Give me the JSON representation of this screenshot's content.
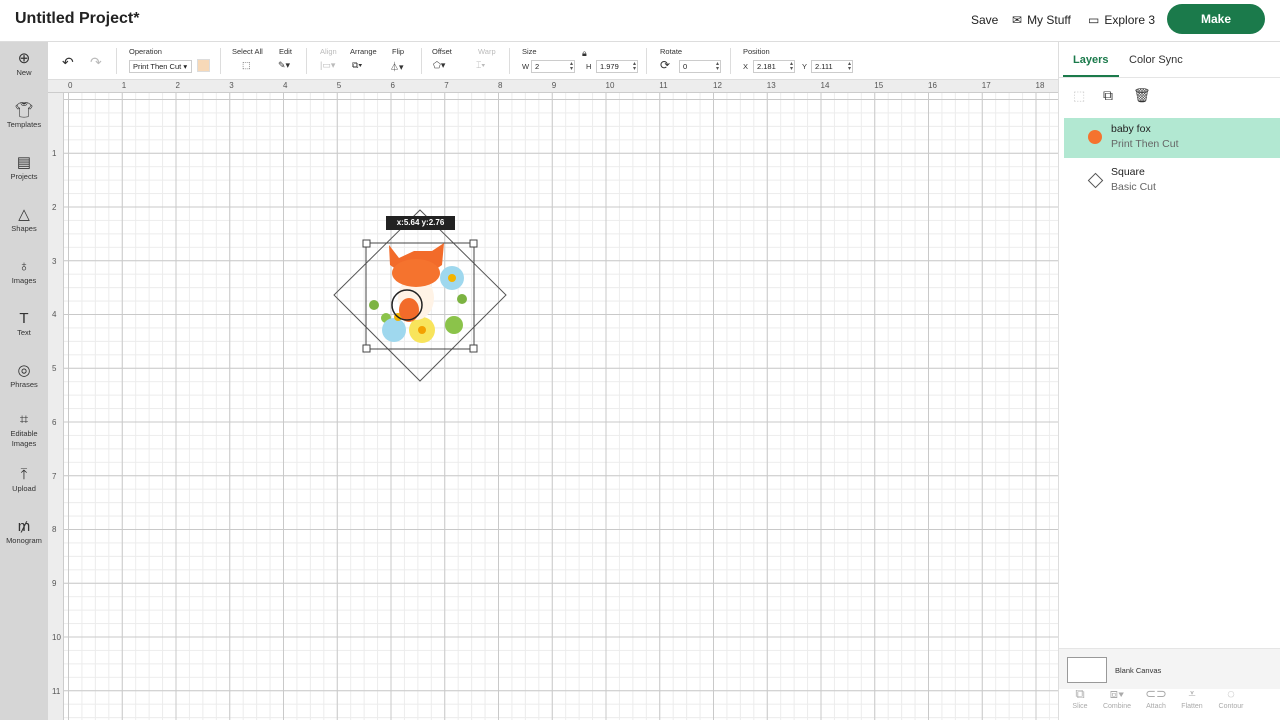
{
  "header": {
    "title": "Untitled Project*",
    "save": "Save",
    "my_stuff": "My Stuff",
    "machine": "Explore 3",
    "make": "Make",
    "brand_color": "#1b7a4b"
  },
  "sidebar": {
    "items": [
      {
        "label": "New",
        "icon": "plus-circle-icon"
      },
      {
        "label": "Templates",
        "icon": "shirt-icon"
      },
      {
        "label": "Projects",
        "icon": "clipboard-icon"
      },
      {
        "label": "Shapes",
        "icon": "shapes-icon"
      },
      {
        "label": "Images",
        "icon": "lightbulb-icon"
      },
      {
        "label": "Text",
        "icon": "text-icon"
      },
      {
        "label": "Phrases",
        "icon": "speech-bubble-icon"
      },
      {
        "label": "Editable Images",
        "icon": "edit-nodes-icon"
      },
      {
        "label": "Upload",
        "icon": "upload-icon"
      },
      {
        "label": "Monogram",
        "icon": "monogram-icon"
      }
    ]
  },
  "toolbar": {
    "operation_label": "Operation",
    "operation_value": "Print Then Cut",
    "select_all": "Select All",
    "edit": "Edit",
    "align": "Align",
    "arrange": "Arrange",
    "flip": "Flip",
    "offset": "Offset",
    "warp": "Warp",
    "size": "Size",
    "w_label": "W",
    "w": "2",
    "h_label": "H",
    "h": "1.979",
    "rotate": "Rotate",
    "rotate_value": "0",
    "position": "Position",
    "x_label": "X",
    "x": "2.181",
    "y_label": "Y",
    "y": "2.111"
  },
  "ruler": {
    "h": [
      "0",
      "1",
      "2",
      "3",
      "4",
      "5",
      "6",
      "7",
      "8",
      "9",
      "10",
      "11",
      "12",
      "13",
      "14",
      "15",
      "16",
      "17",
      "18"
    ],
    "v": [
      "1",
      "2",
      "3",
      "4",
      "5",
      "6",
      "7",
      "8",
      "9",
      "10",
      "11"
    ]
  },
  "canvas": {
    "tooltip": "x:5.64 y:2.76"
  },
  "panel": {
    "tabs": [
      "Layers",
      "Color Sync"
    ],
    "layers": [
      {
        "name": "baby fox",
        "op": "Print Then Cut",
        "selected": true,
        "highlight": "#b2e8d2"
      },
      {
        "name": "Square",
        "op": "Basic Cut",
        "selected": false
      }
    ],
    "blank_canvas": "Blank Canvas",
    "actions": [
      "Slice",
      "Combine",
      "Attach",
      "Flatten",
      "Contour"
    ]
  }
}
